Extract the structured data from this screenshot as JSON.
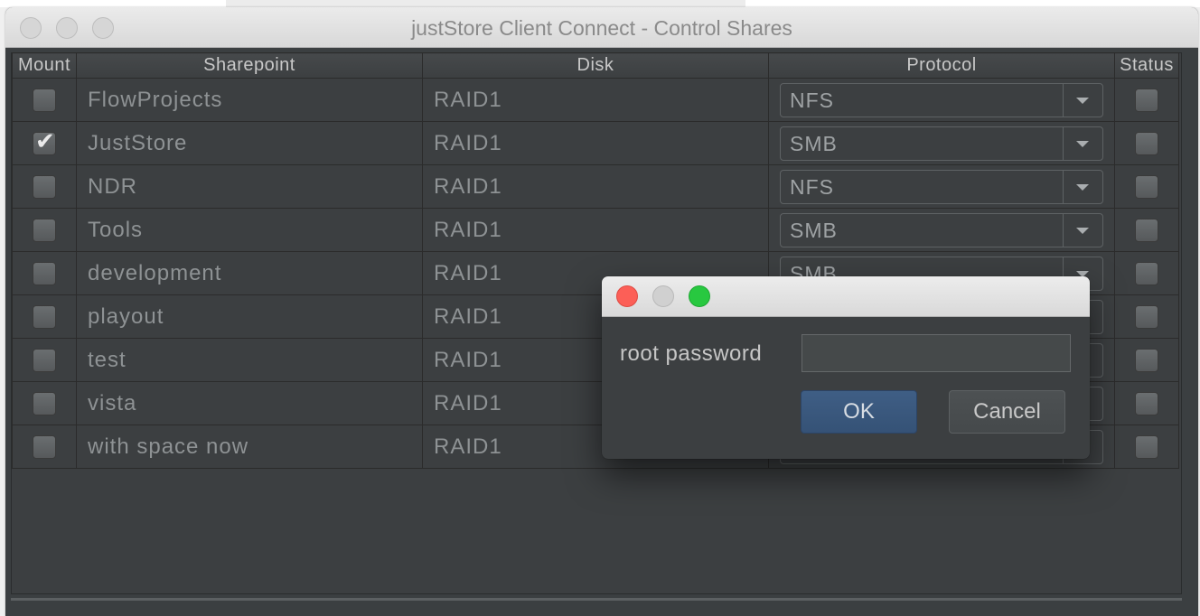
{
  "window": {
    "title": "justStore Client Connect - Control Shares"
  },
  "table": {
    "columns": [
      "Mount",
      "Sharepoint",
      "Disk",
      "Protocol",
      "Status"
    ],
    "rows": [
      {
        "mounted": false,
        "sharepoint": "FlowProjects",
        "disk": "RAID1",
        "protocol": "NFS",
        "status": false
      },
      {
        "mounted": true,
        "sharepoint": "JustStore",
        "disk": "RAID1",
        "protocol": "SMB",
        "status": false
      },
      {
        "mounted": false,
        "sharepoint": "NDR",
        "disk": "RAID1",
        "protocol": "NFS",
        "status": false
      },
      {
        "mounted": false,
        "sharepoint": "Tools",
        "disk": "RAID1",
        "protocol": "SMB",
        "status": false
      },
      {
        "mounted": false,
        "sharepoint": "development",
        "disk": "RAID1",
        "protocol": "SMB",
        "status": false
      },
      {
        "mounted": false,
        "sharepoint": "playout",
        "disk": "RAID1",
        "protocol": "",
        "status": false
      },
      {
        "mounted": false,
        "sharepoint": "test",
        "disk": "RAID1",
        "protocol": "",
        "status": false
      },
      {
        "mounted": false,
        "sharepoint": "vista",
        "disk": "RAID1",
        "protocol": "",
        "status": false
      },
      {
        "mounted": false,
        "sharepoint": "with space now",
        "disk": "RAID1",
        "protocol": "",
        "status": false
      }
    ]
  },
  "dialog": {
    "label": "root password",
    "password_value": "",
    "ok_label": "OK",
    "cancel_label": "Cancel"
  },
  "colors": {
    "close": "#fc5f57",
    "minimize": "#d0d0d0",
    "zoom": "#28c840",
    "ok_button": "#3b5a80"
  }
}
